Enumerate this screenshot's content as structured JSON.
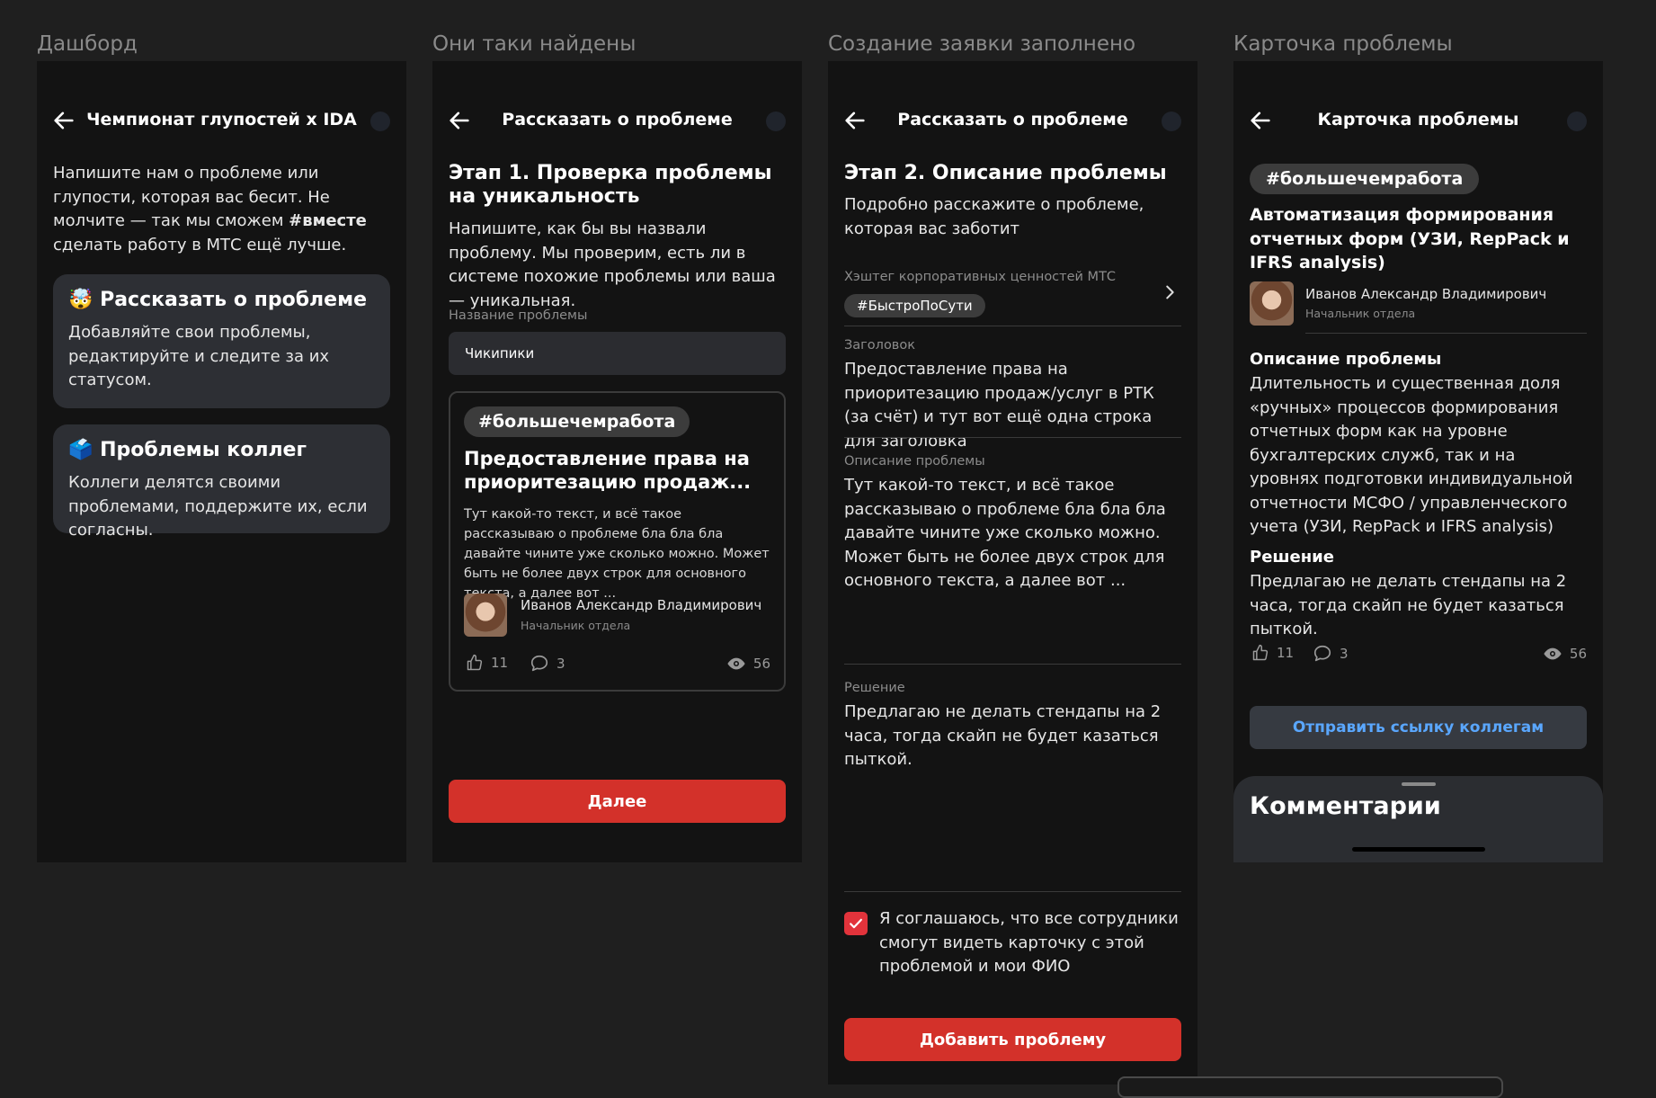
{
  "frames": {
    "dashboard": {
      "frame_title": "Дашборд",
      "title": "Чемпионат глупостей x IDA",
      "intro_before": "Напишите нам о проблеме или глупости, которая вас бесит. Не молчите — так мы сможем ",
      "intro_bold": "#вместе",
      "intro_after": " сделать работу в МТС ещё лучше.",
      "card1": {
        "emoji": "🤯",
        "title": "Рассказать о проблеме",
        "text": "Добавляйте свои проблемы, редактируйте и следите за их статусом."
      },
      "card2": {
        "emoji": "🗳️",
        "title": "Проблемы коллег",
        "text": "Коллеги делятся своими проблемами, поддержите их, если согласны."
      }
    },
    "found": {
      "frame_title": "Они таки найдены",
      "title": "Рассказать о проблеме",
      "step_title": "Этап 1. Проверка проблемы на уникальность",
      "step_text": "Напишите, как бы вы назвали проблему. Мы проверим, есть ли в системе похожие проблемы или ваша — уникальная.",
      "field_label": "Название проблемы",
      "field_value": "Чикипики",
      "card": {
        "tag": "#большечемработа",
        "title": "Предоставление права на приоритезацию продаж...",
        "text": "Тут какой-то текст, и всё такое рассказываю о проблеме бла бла бла давайте чините уже сколько можно. Может быть не более двух строк для основного текста, а далее вот ...",
        "author": "Иванов Александр Владимирович",
        "role": "Начальник отдела",
        "likes": "11",
        "comments": "3",
        "views": "56"
      },
      "next_button": "Далее"
    },
    "filled": {
      "frame_title": "Создание заявки заполнено",
      "title": "Рассказать о проблеме",
      "step_title": "Этап 2. Описание проблемы",
      "step_text": "Подробно расскажите о проблеме, которая вас заботит",
      "hashtag_label": "Хэштег корпоративных ценностей МТС",
      "hashtag_value": "#БыстроПоСути",
      "heading_label": "Заголовок",
      "heading_value": "Предоставление права на приоритезацию продаж/услуг в РТК (за счёт) и тут вот ещё одна строка для заголовка",
      "desc_label": "Описание проблемы",
      "desc_value": "Тут какой-то текст, и всё такое рассказываю о проблеме бла бла бла давайте чините уже сколько можно. Может быть не более двух строк для основного текста, а далее вот ...",
      "solution_label": "Решение",
      "solution_value": "Предлагаю не делать стендапы на 2 часа, тогда скайп не будет казаться пыткой.",
      "consent": "Я соглашаюсь, что все сотрудники смогут видеть карточку с этой проблемой и мои ФИО",
      "submit_button": "Добавить проблему"
    },
    "detail": {
      "frame_title": "Карточка проблемы",
      "title": "Карточка проблемы",
      "tag": "#большечемработа",
      "problem_title": "Автоматизация формирования отчетных форм (УЗИ, RepPack и IFRS analysis)",
      "author": "Иванов Александр Владимирович",
      "role": "Начальник отдела",
      "desc_heading": "Описание проблемы",
      "desc_text": "Длительность и существенная доля «ручных» процессов формирования отчетных форм как на уровне бухгалтерских служб, так и на уровнях подготовки индивидуальной отчетности МСФО / управленческого учета (УЗИ, RepPack и IFRS analysis)",
      "solution_heading": "Решение",
      "solution_text": "Предлагаю не делать стендапы на 2 часа, тогда скайп не будет казаться пыткой.",
      "likes": "11",
      "comments": "3",
      "views": "56",
      "share_button": "Отправить ссылку коллегам",
      "comments_heading": "Комментарии"
    }
  },
  "colors": {
    "accent_red": "#d3312a",
    "link_blue": "#5aa7ff",
    "screen_bg": "#131313",
    "page_bg": "#1f1f1f"
  }
}
